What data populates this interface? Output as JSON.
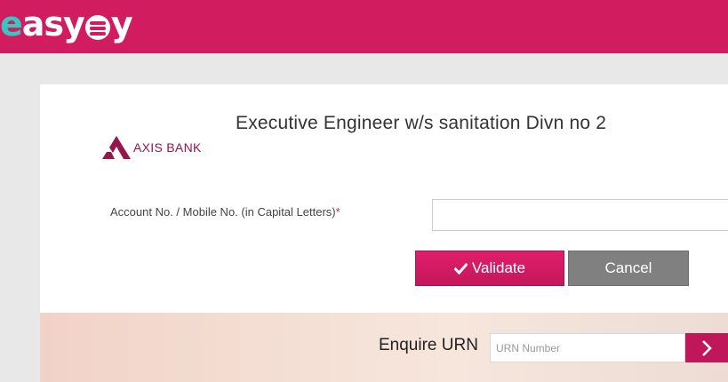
{
  "header": {
    "brand_e": "e",
    "brand_asy": "asy",
    "brand_y": "y",
    "brand_name": "easypay",
    "brand_color": "#d11c60"
  },
  "merchant": {
    "bank_name": "AXIS BANK",
    "title": "Executive Engineer w/s sanitation Divn no 2"
  },
  "form": {
    "account_label": "Account No. / Mobile No. (in Capital Letters)",
    "required_mark": "*",
    "account_value": "",
    "validate_label": "Validate",
    "validate_icon": "check-icon",
    "cancel_label": "Cancel"
  },
  "enquire": {
    "label": "Enquire URN",
    "placeholder": "URN Number",
    "value": "",
    "go_icon": "chevron-right-icon"
  },
  "colors": {
    "accent": "#d11c60",
    "cancel": "#808080"
  }
}
